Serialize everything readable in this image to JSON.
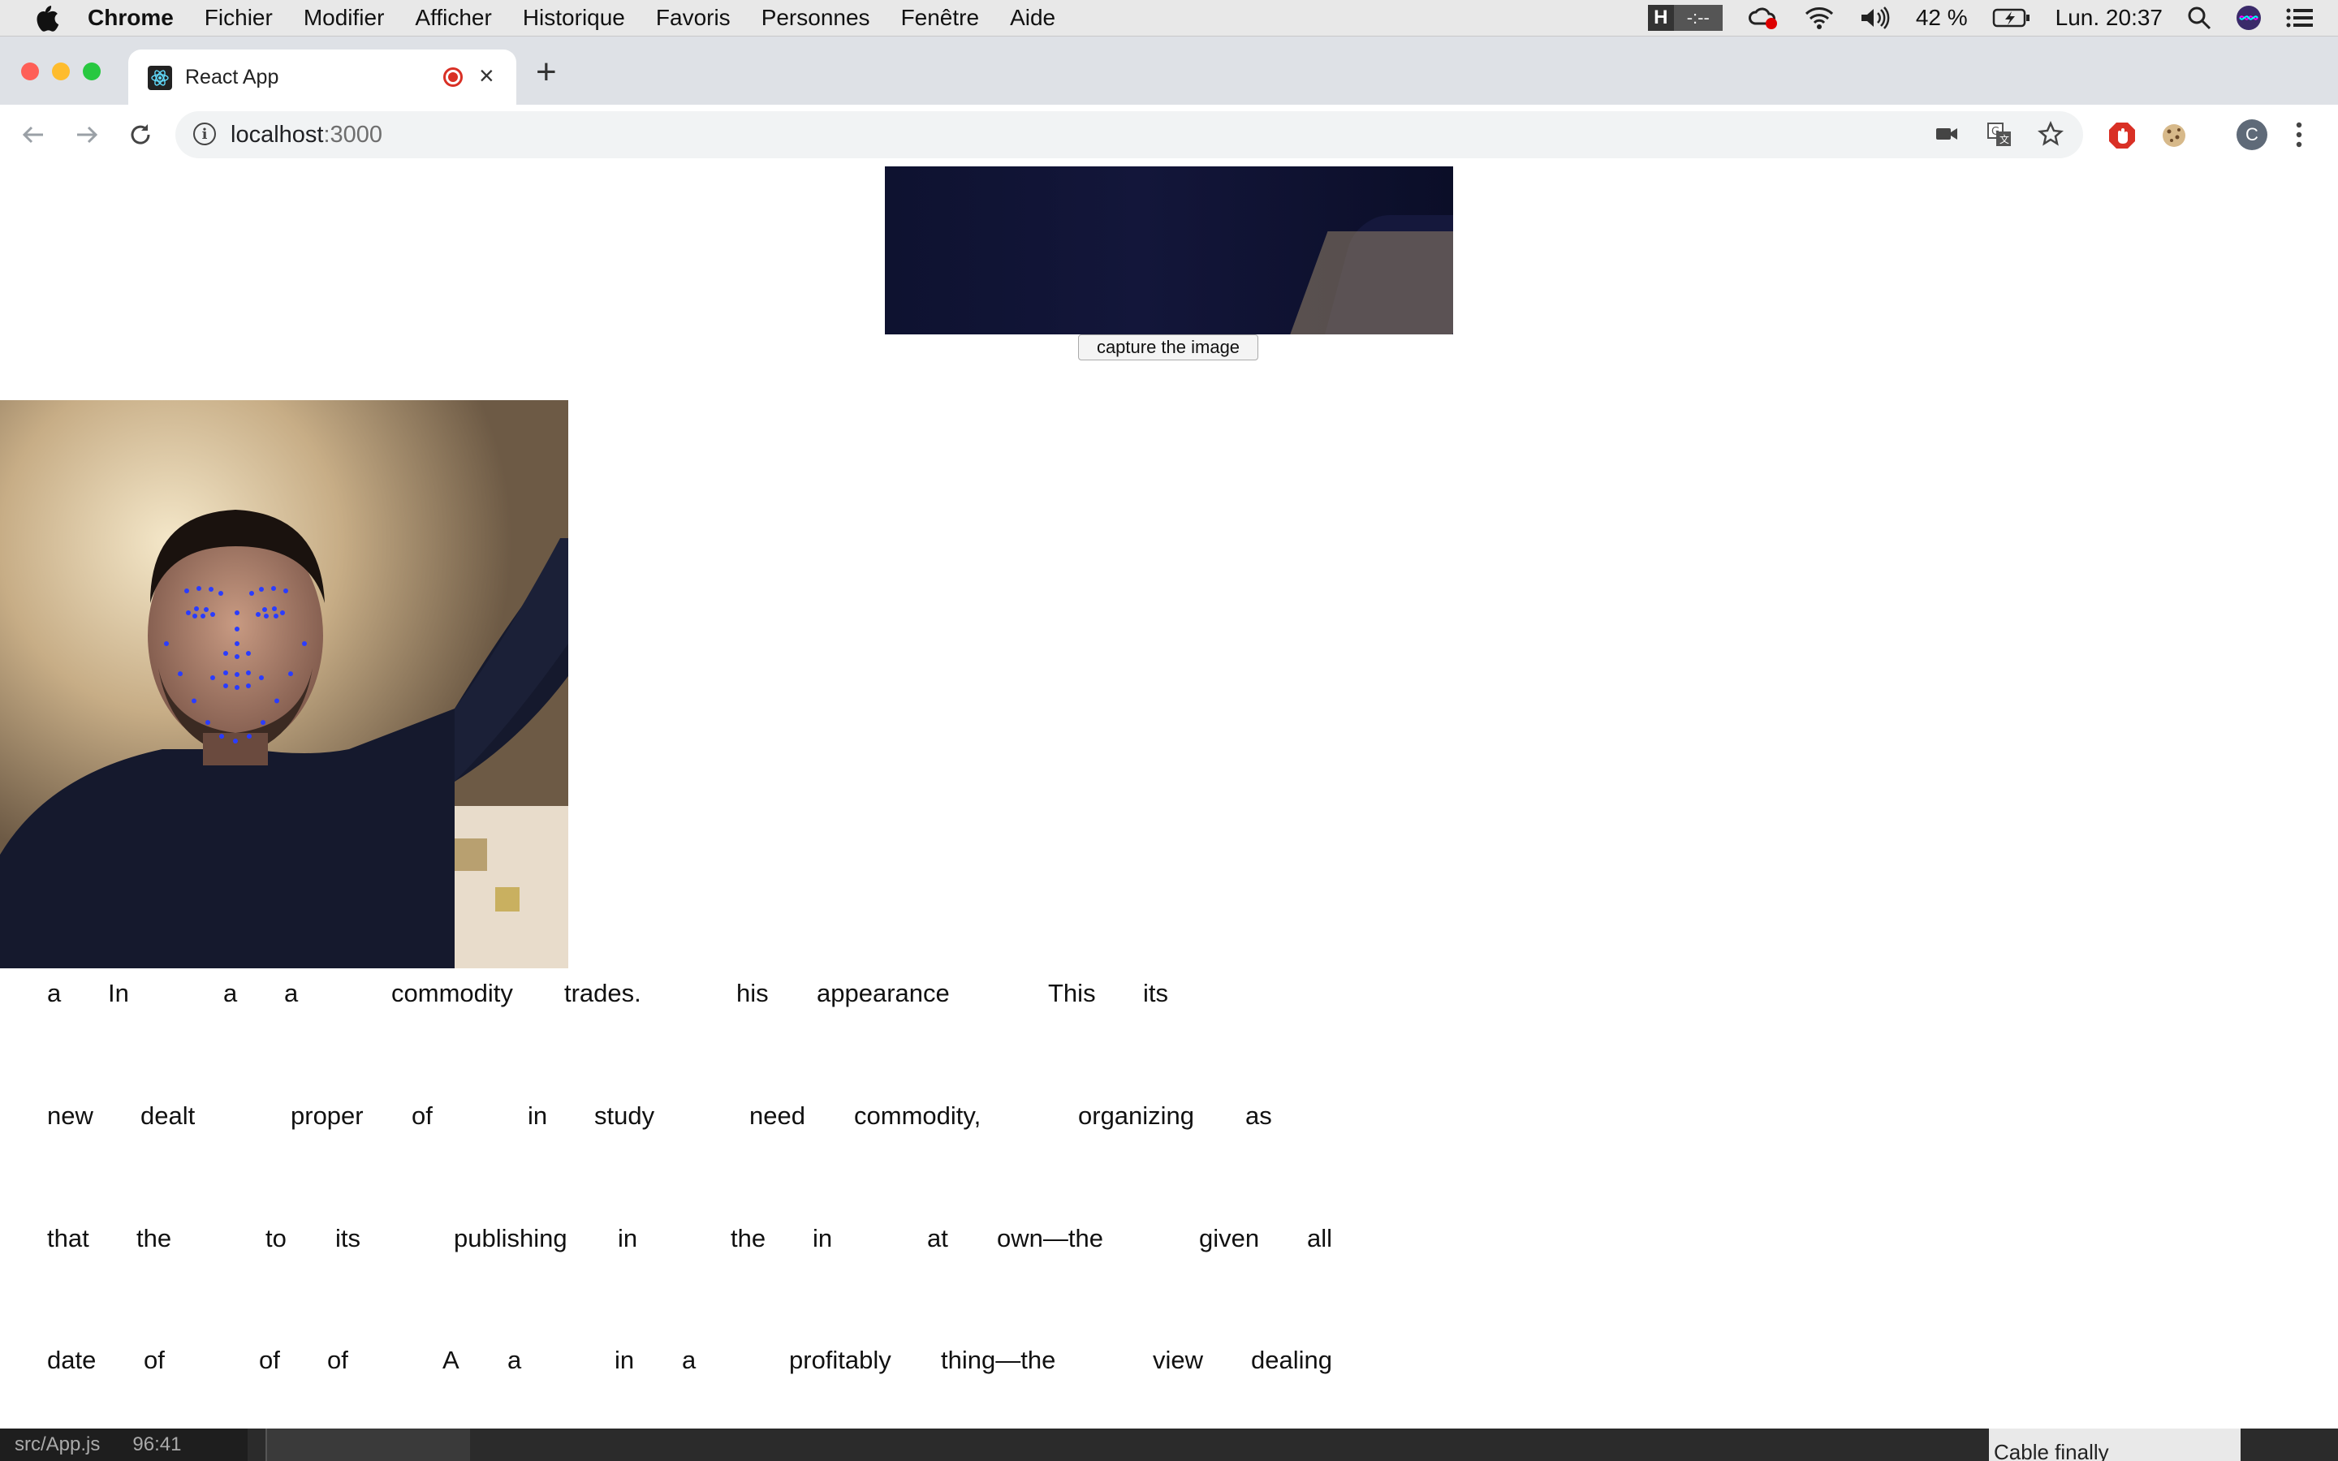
{
  "menubar": {
    "app": "Chrome",
    "items": [
      "Fichier",
      "Modifier",
      "Afficher",
      "Historique",
      "Favoris",
      "Personnes",
      "Fenêtre",
      "Aide"
    ],
    "status": {
      "hbadge_letter": "H",
      "hbadge_time": "-:--",
      "battery": "42 %",
      "clock": "Lun. 20:37"
    }
  },
  "browser": {
    "tab_title": "React App",
    "new_tab": "+",
    "close_tab": "×",
    "url_host": "localhost",
    "url_port": ":3000",
    "profile_initial": "C"
  },
  "page": {
    "capture_button": "capture the image",
    "words": [
      [
        "a",
        "In",
        "a",
        "a",
        "commodity",
        "trades.",
        "his",
        "appearance",
        "This",
        "its"
      ],
      [
        "new",
        "dealt",
        "proper",
        "of",
        "in",
        "study",
        "need",
        "commodity,",
        "organizing",
        "as"
      ],
      [
        "that",
        "the",
        "to",
        "its",
        "publishing",
        "in",
        "the",
        "in",
        "at",
        "own—the",
        "given",
        "all"
      ],
      [
        "date",
        "of",
        "of",
        "of",
        "A",
        "a",
        "in",
        "a",
        "profitably",
        "thing—the",
        "view",
        "dealing"
      ]
    ]
  },
  "editor": {
    "file": "src/App.js",
    "position": "96:41",
    "right_text": "Cable finally"
  },
  "colors": {
    "record": "#d93025",
    "landmarks": "#2a3cff",
    "tabstrip": "#dee1e6"
  }
}
